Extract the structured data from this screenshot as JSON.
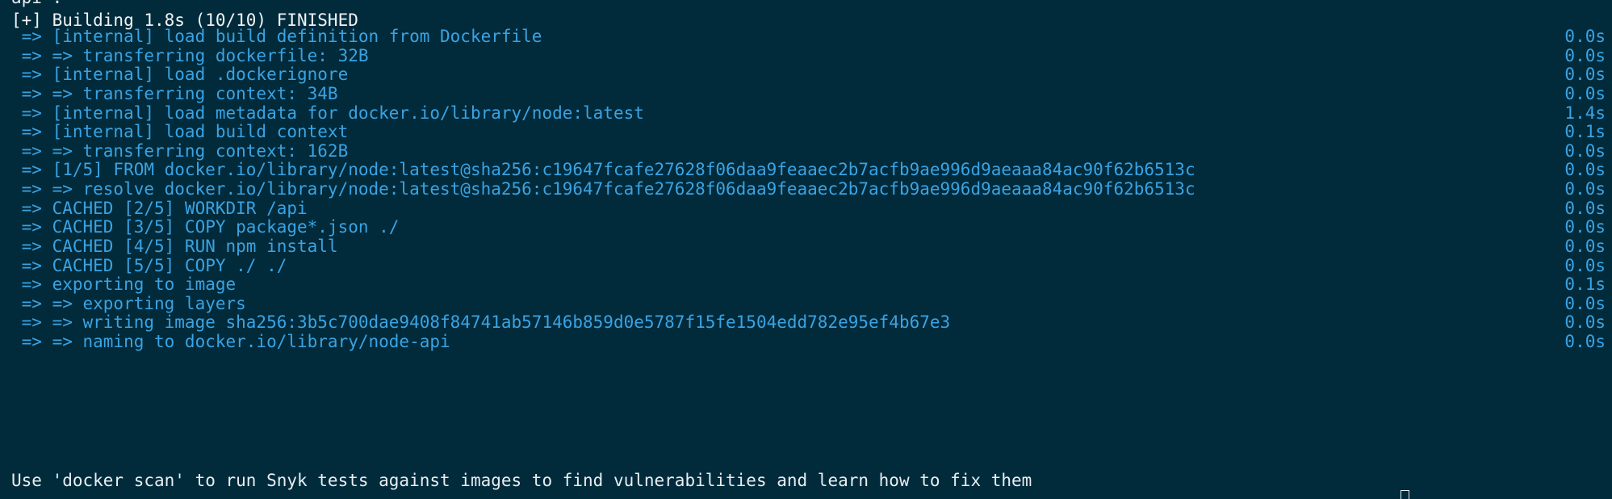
{
  "terminal": {
    "cut_line": "api :",
    "header": "[+] Building 1.8s (10/10) FINISHED",
    "steps": [
      {
        "text": " => [internal] load build definition from Dockerfile",
        "time": "0.0s"
      },
      {
        "text": " => => transferring dockerfile: 32B",
        "time": "0.0s"
      },
      {
        "text": " => [internal] load .dockerignore",
        "time": "0.0s"
      },
      {
        "text": " => => transferring context: 34B",
        "time": "0.0s"
      },
      {
        "text": " => [internal] load metadata for docker.io/library/node:latest",
        "time": "1.4s"
      },
      {
        "text": " => [internal] load build context",
        "time": "0.1s"
      },
      {
        "text": " => => transferring context: 162B",
        "time": "0.0s"
      },
      {
        "text": " => [1/5] FROM docker.io/library/node:latest@sha256:c19647fcafe27628f06daa9feaaec2b7acfb9ae996d9aeaaa84ac90f62b6513c",
        "time": "0.0s"
      },
      {
        "text": " => => resolve docker.io/library/node:latest@sha256:c19647fcafe27628f06daa9feaaec2b7acfb9ae996d9aeaaa84ac90f62b6513c",
        "time": "0.0s"
      },
      {
        "text": " => CACHED [2/5] WORKDIR /api",
        "time": "0.0s"
      },
      {
        "text": " => CACHED [3/5] COPY package*.json ./",
        "time": "0.0s"
      },
      {
        "text": " => CACHED [4/5] RUN npm install",
        "time": "0.0s"
      },
      {
        "text": " => CACHED [5/5] COPY ./ ./",
        "time": "0.0s"
      },
      {
        "text": " => exporting to image",
        "time": "0.1s"
      },
      {
        "text": " => => exporting layers",
        "time": "0.0s"
      },
      {
        "text": " => => writing image sha256:3b5c700dae9408f84741ab57146b859d0e5787f15fe1504edd782e95ef4b67e3",
        "time": "0.0s"
      },
      {
        "text": " => => naming to docker.io/library/node-api",
        "time": "0.0s"
      }
    ],
    "hint": "Use 'docker scan' to run Snyk tests against images to find vulnerabilities and learn how to fix them",
    "prompt": ""
  },
  "colors": {
    "background": "#012b3b",
    "text": "#e8eef2",
    "step_text": "#3aa3e3"
  }
}
